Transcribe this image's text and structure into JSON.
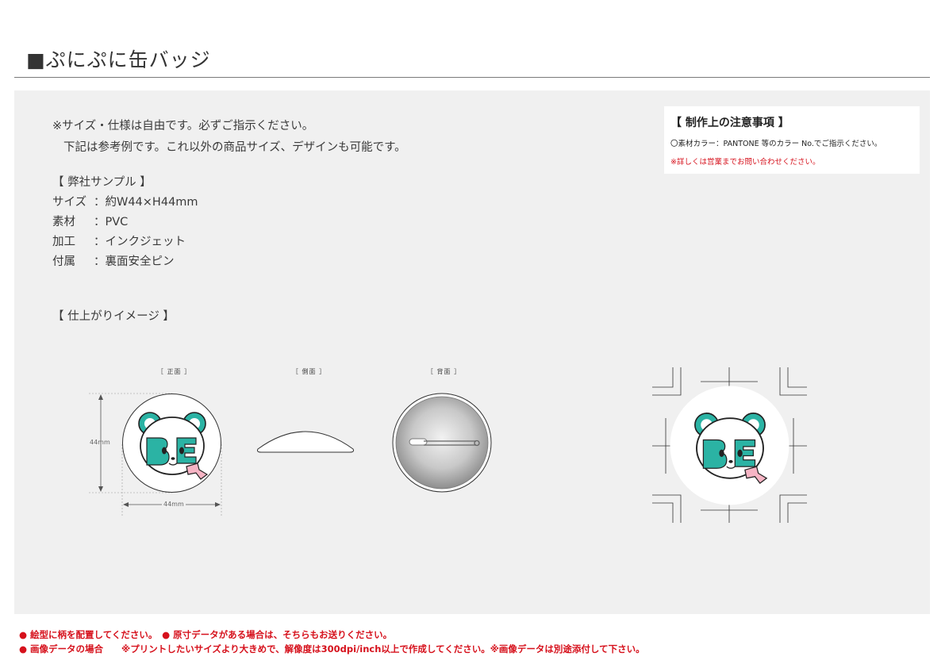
{
  "header": {
    "title": "■ぷにぷに缶バッジ"
  },
  "intro": {
    "line1": "※サイズ・仕様は自由です。必ずご指示ください。",
    "line2": "下記は参考例です。これ以外の商品サイズ、デザインも可能です。"
  },
  "sample": {
    "heading": "【 弊社サンプル 】",
    "specs": [
      {
        "label": "サイズ",
        "value": "：約W44×H44mm"
      },
      {
        "label": "素材",
        "value": "：PVC"
      },
      {
        "label": "加工",
        "value": "：インクジェット"
      },
      {
        "label": "付属",
        "value": "：裏面安全ピン"
      }
    ]
  },
  "finish": {
    "heading": "【 仕上がりイメージ 】",
    "views": {
      "front": "［ 正面 ］",
      "side": "［ 側面 ］",
      "back": "［ 背面 ］"
    },
    "dimensions": {
      "height": "44mm",
      "width": "44mm"
    }
  },
  "notice": {
    "title": "【 制作上の注意事項 】",
    "line1": "〇素材カラー：PANTONE 等のカラー No.でご指示ください。",
    "line2": "※詳しくは営業までお問い合わせください。"
  },
  "footer": {
    "line1": "● 絵型に柄を配置してください。　● 原寸データがある場合は、そちらもお送りください。",
    "line2": "● 画像データの場合　　※プリントしたいサイズより大きめで、解像度は300dpi/inch以上で作成してください。※画像データは別途添付して下さい。"
  },
  "colors": {
    "accent_red": "#d6111c",
    "teal": "#2bb3a4",
    "panel": "#f0f0f0"
  }
}
